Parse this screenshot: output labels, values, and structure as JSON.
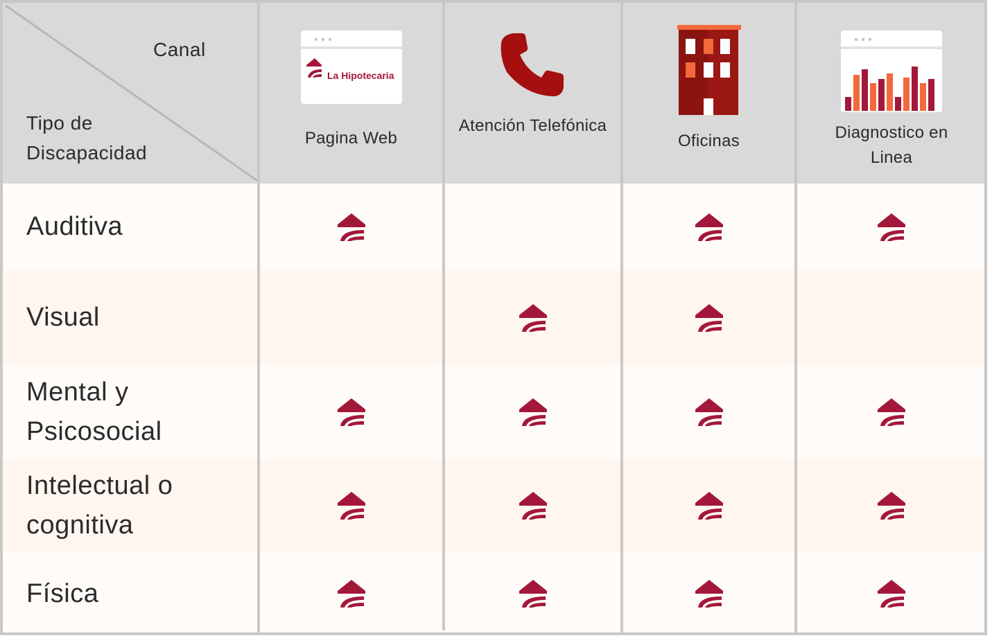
{
  "header": {
    "corner_top": "Canal",
    "corner_bottom_line1": "Tipo de",
    "corner_bottom_line2": "Discapacidad"
  },
  "channels": [
    {
      "label": "Pagina Web",
      "icon": "web-page-icon",
      "logo_text": "La Hipotecaria"
    },
    {
      "label": "Atención Telefónica",
      "icon": "phone-icon"
    },
    {
      "label": "Oficinas",
      "icon": "office-building-icon"
    },
    {
      "label_line1": "Diagnostico en",
      "label_line2": "Linea",
      "icon": "online-chart-icon"
    }
  ],
  "rows": [
    {
      "line1": "Auditiva",
      "line2": "",
      "marks": [
        true,
        false,
        true,
        true
      ]
    },
    {
      "line1": "Visual",
      "line2": "",
      "marks": [
        false,
        true,
        true,
        false
      ]
    },
    {
      "line1": "Mental y",
      "line2": "Psicosocial",
      "marks": [
        true,
        true,
        true,
        true
      ]
    },
    {
      "line1": "Intelectual o",
      "line2": "cognitiva",
      "marks": [
        true,
        true,
        true,
        true
      ]
    },
    {
      "line1": "Física",
      "line2": "",
      "marks": [
        true,
        true,
        true,
        true
      ]
    }
  ],
  "colors": {
    "header_bg": "#d9d9d9",
    "brand_red": "#a3183a",
    "phone_red": "#a50f0f",
    "building_dark": "#8e1510",
    "accent_orange": "#f26a3b",
    "row_light": "#fffbf8",
    "row_dark": "#fff6ef"
  }
}
